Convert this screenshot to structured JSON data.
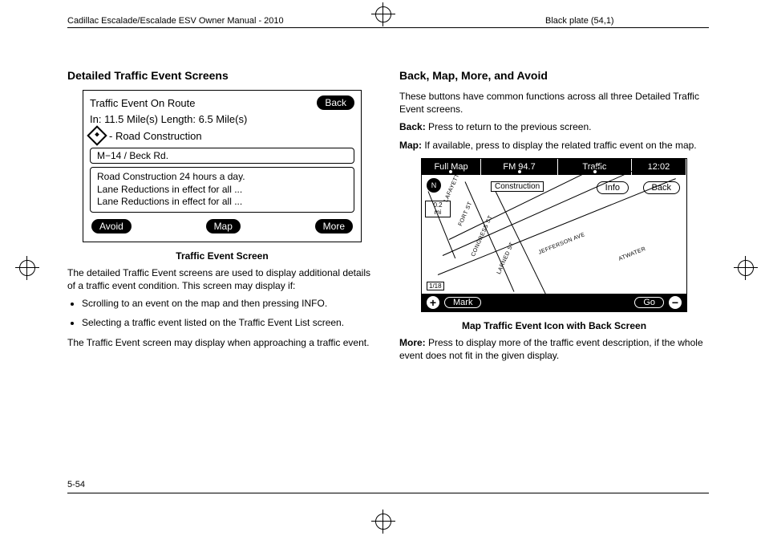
{
  "header": {
    "left": "Cadillac Escalade/Escalade ESV Owner Manual - 2010",
    "right": "Black plate (54,1)"
  },
  "page_number": "5-54",
  "left_col": {
    "heading": "Detailed Traffic Event Screens",
    "fig1": {
      "title": "Traffic Event On Route",
      "back": "Back",
      "sub": "In: 11.5 Mile(s)  Length: 6.5 Mile(s)",
      "road_type": "- Road Construction",
      "location": "M−14 / Beck Rd.",
      "desc_l1": "Road Construction 24 hours a day.",
      "desc_l2": "Lane Reductions in effect for all ...",
      "desc_l3": "Lane Reductions in effect for all ...",
      "avoid": "Avoid",
      "map": "Map",
      "more": "More"
    },
    "caption": "Traffic Event Screen",
    "p1": "The detailed Traffic Event screens are used to display additional details of a traffic event condition. This screen may display if:",
    "b1": "Scrolling to an event on the map and then pressing INFO.",
    "b2": "Selecting a traffic event listed on the Traffic Event List screen.",
    "p2": "The Traffic Event screen may display when approaching a traffic event."
  },
  "right_col": {
    "heading": "Back, Map, More, and Avoid",
    "p1": "These buttons have common functions across all three Detailed Traffic Event screens.",
    "back_label": "Back:",
    "back_text": " Press to return to the previous screen.",
    "map_label": "Map:",
    "map_text": " If available, press to display the related traffic event on the map.",
    "fig2": {
      "full_map": "Full Map",
      "fm": "FM 94.7",
      "traffic": "Traffic",
      "time": "12:02",
      "compass": "N",
      "scale_val": "0.2",
      "scale_unit": "mi",
      "construction": "Construction",
      "info": "Info",
      "back": "Back",
      "mark": "Mark",
      "go": "Go",
      "range": "1/18",
      "streets": {
        "lafayette": "LAFAYETTE",
        "fort": "FORT ST",
        "congress": "CONGRESS ST",
        "larned": "LARNED ST",
        "jefferson": "JEFFERSON AVE",
        "atwater": "ATWATER"
      }
    },
    "caption": "Map Traffic Event Icon with Back Screen",
    "more_label": "More:",
    "more_text": " Press to display more of the traffic event description, if the whole event does not fit in the given display."
  }
}
